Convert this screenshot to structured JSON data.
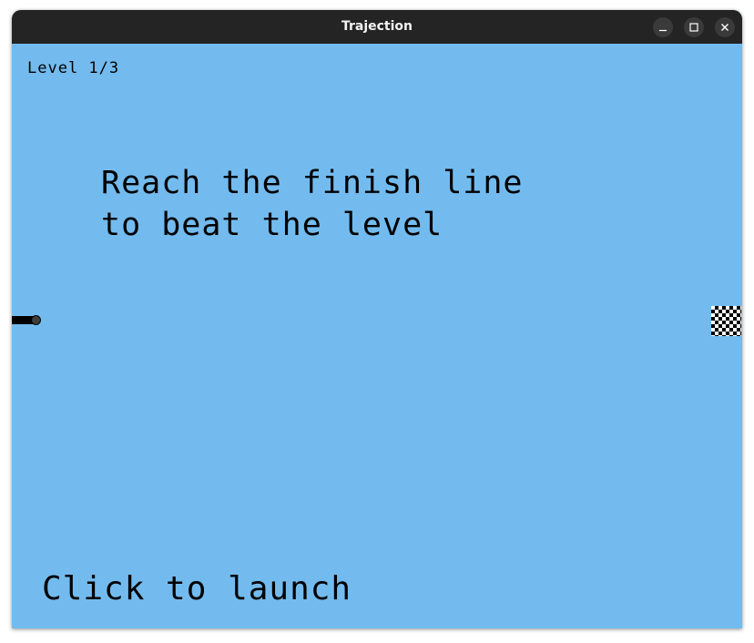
{
  "window": {
    "title": "Trajection",
    "controls": {
      "minimize_icon": "minimize-icon",
      "maximize_icon": "maximize-icon",
      "close_icon": "close-icon"
    }
  },
  "game": {
    "level_label": "Level 1/3",
    "hint_line1": "Reach the finish line",
    "hint_line2": "to beat the level",
    "launch_prompt": "Click to launch",
    "colors": {
      "sky": "#73bbee",
      "titlebar": "#242424",
      "text": "#000000"
    }
  }
}
